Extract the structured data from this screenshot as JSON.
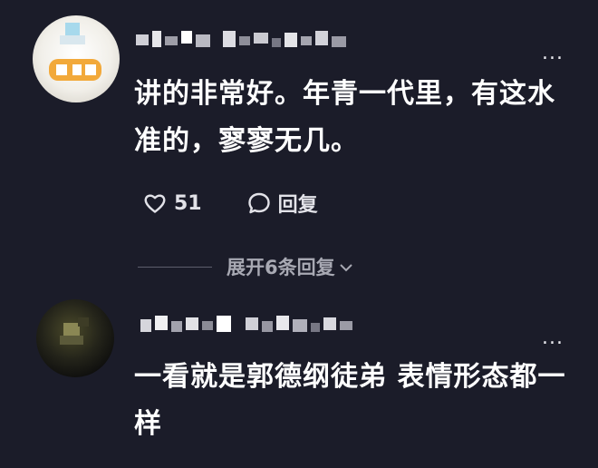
{
  "comments": [
    {
      "avatar_icon": "user-avatar-icon",
      "more_label": "...",
      "text": "讲的非常好。年青一代里，有这水准的，寥寥无几。",
      "like_icon": "heart-outline-icon",
      "like_count": "51",
      "reply_icon": "chat-bubble-icon",
      "reply_label": "回复",
      "expand_replies_label": "展开6条回复",
      "expand_icon": "chevron-down-icon"
    },
    {
      "avatar_icon": "user-avatar-icon",
      "more_label": "...",
      "text": "一看就是郭德纲徒弟 表情形态都一样"
    }
  ],
  "colors": {
    "background": "#1b1c29",
    "text_primary": "#ffffff",
    "text_secondary": "#a8a9b3"
  }
}
